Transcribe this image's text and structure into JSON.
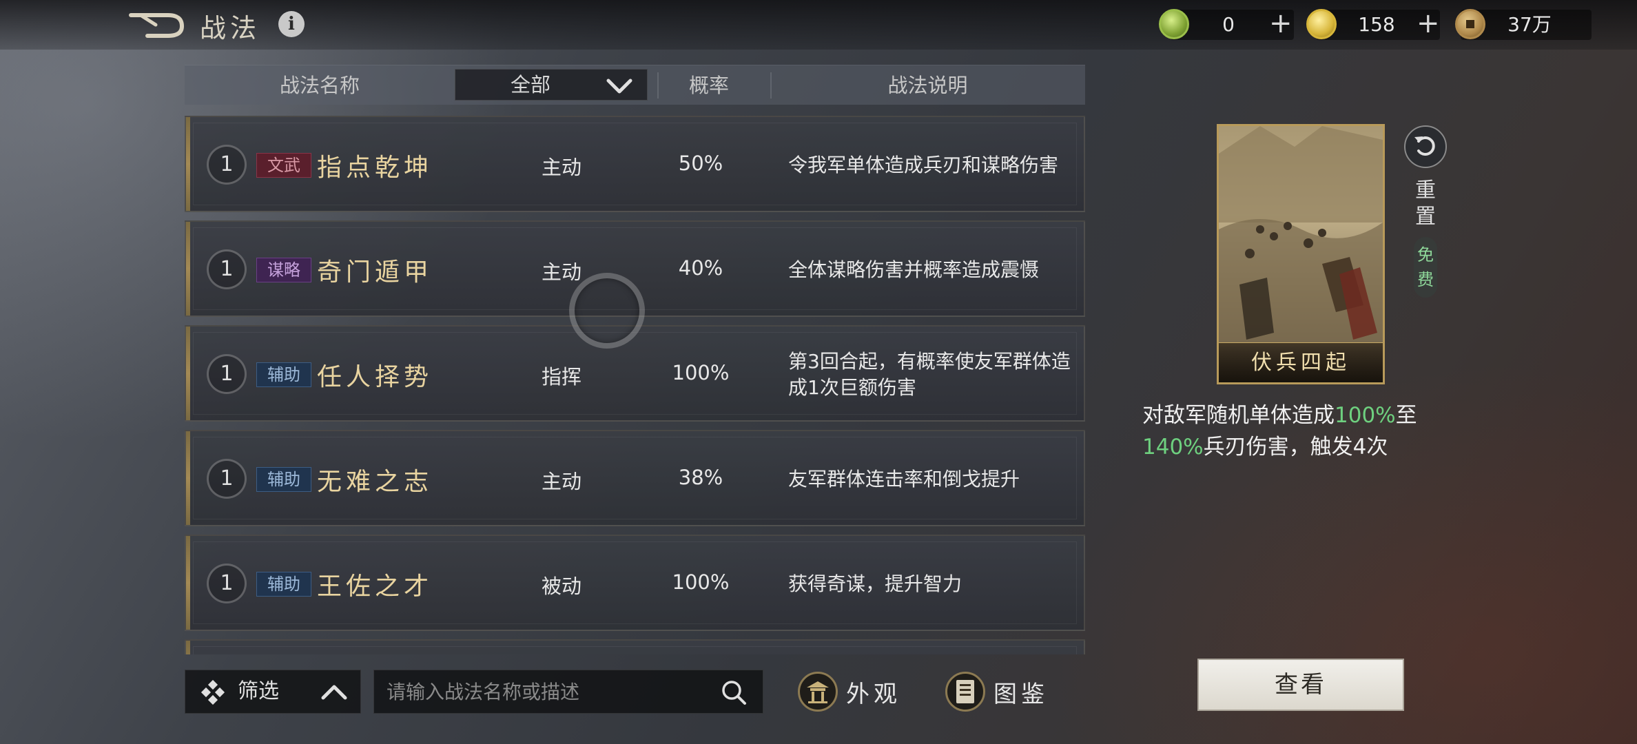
{
  "header": {
    "title": "战法",
    "info_icon": "info-icon",
    "back_icon": "back-arrow-icon"
  },
  "currencies": [
    {
      "icon": "jade-coin-icon",
      "value": "0",
      "has_plus": true,
      "color": "#9bbf4a"
    },
    {
      "icon": "gold-coin-icon",
      "value": "158",
      "has_plus": true,
      "color": "#d7b63a"
    },
    {
      "icon": "copper-coin-icon",
      "value": "37万",
      "has_plus": false,
      "color": "#b08a4c"
    }
  ],
  "table": {
    "col_name": "战法名称",
    "col_filter": "全部",
    "col_rate": "概率",
    "col_desc": "战法说明",
    "rows": [
      {
        "level": "1",
        "tag": "文武",
        "tag_style": "wenwu",
        "name": "指点乾坤",
        "type": "主动",
        "rate": "50%",
        "desc": "令我军单体造成兵刃和谋略伤害"
      },
      {
        "level": "1",
        "tag": "谋略",
        "tag_style": "moulue",
        "name": "奇门遁甲",
        "type": "主动",
        "rate": "40%",
        "desc": "全体谋略伤害并概率造成震慑"
      },
      {
        "level": "1",
        "tag": "辅助",
        "tag_style": "fuzhu",
        "name": "任人择势",
        "type": "指挥",
        "rate": "100%",
        "desc": "第3回合起，有概率使友军群体造成1次巨额伤害"
      },
      {
        "level": "1",
        "tag": "辅助",
        "tag_style": "fuzhu",
        "name": "无难之志",
        "type": "主动",
        "rate": "38%",
        "desc": "友军群体连击率和倒戈提升"
      },
      {
        "level": "1",
        "tag": "辅助",
        "tag_style": "fuzhu",
        "name": "王佐之才",
        "type": "被动",
        "rate": "100%",
        "desc": "获得奇谋，提升智力"
      }
    ]
  },
  "bottom": {
    "filter_label": "筛选",
    "search_placeholder": "请输入战法名称或描述",
    "appearance_label": "外观",
    "codex_label": "图鉴"
  },
  "detail": {
    "card_name": "伏兵四起",
    "reset_label": "重置",
    "free_label": "免费",
    "desc_prefix": "对敌军随机单体造成",
    "desc_hl1": "100%",
    "desc_mid": "至",
    "desc_hl2": "140%",
    "desc_suffix": "兵刃伤害，触发4次",
    "view_button": "查看"
  }
}
